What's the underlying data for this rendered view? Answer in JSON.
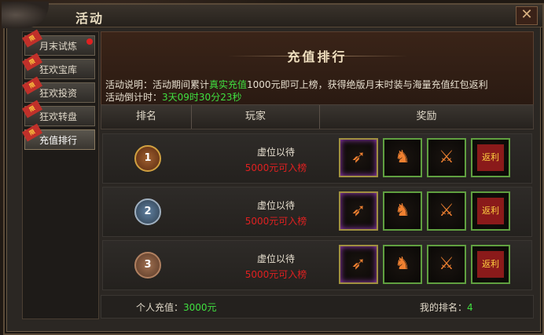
{
  "window": {
    "title": "活动",
    "close_label": "✕"
  },
  "sidebar": {
    "items": [
      {
        "label": "月末试炼",
        "flag": "限"
      },
      {
        "label": "狂欢宝库",
        "flag": "限"
      },
      {
        "label": "狂欢投资",
        "flag": "限"
      },
      {
        "label": "狂欢转盘",
        "flag": "限"
      },
      {
        "label": "充值排行",
        "flag": "限"
      }
    ]
  },
  "banner": {
    "title": "充值排行",
    "desc_prefix": "活动说明：活动期间累计",
    "desc_highlight": "真实充值",
    "desc_suffix": "1000元即可上榜，获得绝版月末时装与海量充值红包返利",
    "countdown_label": "活动倒计时：",
    "countdown_value": "3天09时30分23秒"
  },
  "table": {
    "headers": [
      "排名",
      "玩家",
      "奖励"
    ],
    "rows": [
      {
        "rank": "1",
        "player": "虚位以待",
        "req": "5000元可入榜"
      },
      {
        "rank": "2",
        "player": "虚位以待",
        "req": "5000元可入榜"
      },
      {
        "rank": "3",
        "player": "虚位以待",
        "req": "5000元可入榜"
      }
    ],
    "rewards": [
      {
        "icon": "wings-icon",
        "glyph": "➶"
      },
      {
        "icon": "armor-icon",
        "glyph": "♞"
      },
      {
        "icon": "weapon-icon",
        "glyph": "⚔"
      },
      {
        "icon": "red-packet-icon",
        "glyph": "返利"
      }
    ]
  },
  "footer": {
    "recharge_label": "个人充值：",
    "recharge_value": "3000元",
    "rank_label": "我的排名：",
    "rank_value": "4"
  },
  "colors": {
    "accent_green": "#40e040",
    "req_red": "#e02020"
  }
}
